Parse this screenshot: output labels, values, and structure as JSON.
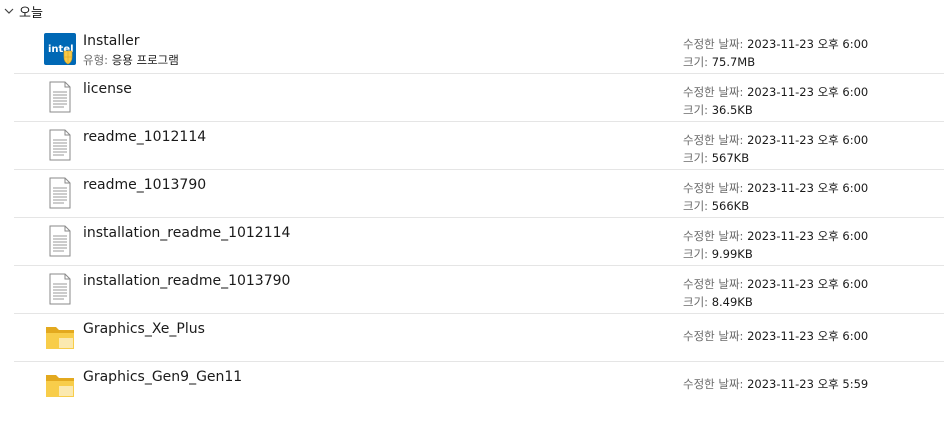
{
  "group": {
    "label": "오늘"
  },
  "labels": {
    "type": "유형:",
    "modified": "수정한 날짜:",
    "size": "크기:"
  },
  "files": [
    {
      "name": "Installer",
      "icon": "intel-installer-icon",
      "type": "응용 프로그램",
      "modified": "2023-11-23 오후 6:00",
      "size": "75.7MB"
    },
    {
      "name": "license",
      "icon": "document-icon",
      "modified": "2023-11-23 오후 6:00",
      "size": "36.5KB"
    },
    {
      "name": "readme_1012114",
      "icon": "document-icon",
      "modified": "2023-11-23 오후 6:00",
      "size": "567KB"
    },
    {
      "name": "readme_1013790",
      "icon": "document-icon",
      "modified": "2023-11-23 오후 6:00",
      "size": "566KB"
    },
    {
      "name": "installation_readme_1012114",
      "icon": "document-icon",
      "modified": "2023-11-23 오후 6:00",
      "size": "9.99KB"
    },
    {
      "name": "installation_readme_1013790",
      "icon": "document-icon",
      "modified": "2023-11-23 오후 6:00",
      "size": "8.49KB"
    },
    {
      "name": "Graphics_Xe_Plus",
      "icon": "folder-icon",
      "modified": "2023-11-23 오후 6:00"
    },
    {
      "name": "Graphics_Gen9_Gen11",
      "icon": "folder-icon",
      "modified": "2023-11-23 오후 5:59"
    }
  ],
  "colors": {
    "intel_blue": "#0068b5",
    "shield_yellow": "#f7c948",
    "folder": "#f4c542",
    "divider": "#e5e5e5"
  }
}
